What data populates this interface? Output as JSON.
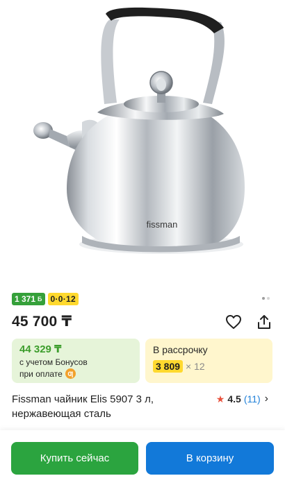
{
  "product": {
    "image_brand": "fissman",
    "price": "45 700 ₸",
    "title": "Fissman чайник Elis 5907 3 л, нержавеющая сталь",
    "rating": "4.5",
    "reviews": "(11)"
  },
  "badges": {
    "bonus_price": "1 371",
    "bonus_glyph": "Б",
    "installment_code": "0·0·12"
  },
  "gallery": {
    "active_index": 1,
    "count": 2
  },
  "bonus_card": {
    "amount": "44 329 ₸",
    "line1": "с учетом Бонусов",
    "line2": "при оплате",
    "coin_glyph": "Ƣ"
  },
  "installment_card": {
    "title": "В рассрочку",
    "amount": "3 809",
    "multiplier": "× 12"
  },
  "actions": {
    "buy_now": "Купить сейчас",
    "add_to_cart": "В корзину"
  },
  "icons": {
    "favorite": "heart-icon",
    "share": "share-icon",
    "rating": "star-icon",
    "more": "chevron-right-icon"
  },
  "colors": {
    "accent_green": "#2ba43f",
    "accent_blue": "#1279d9",
    "bonus_bg": "#e6f4d9",
    "installment_bg": "#fff6cd",
    "badge_yellow": "#ffd92e",
    "star": "#e8513c"
  }
}
